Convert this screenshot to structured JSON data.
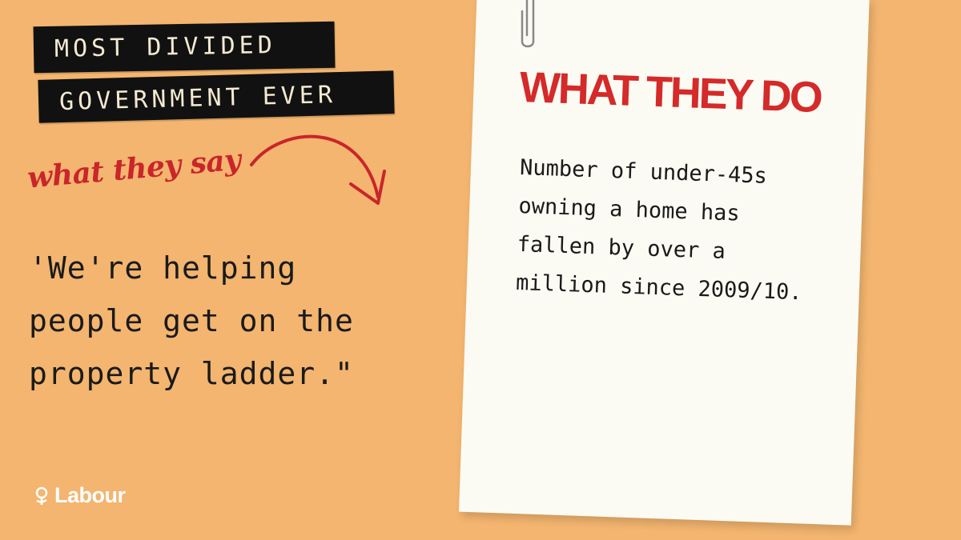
{
  "headline": {
    "line1": "MOST DIVIDED",
    "line2": "GOVERNMENT EVER"
  },
  "what_they_say": {
    "label": "what they say",
    "quote": "'We're helping\npeople get on the\nproperty ladder.\""
  },
  "what_they_do": {
    "title": "WHAT THEY DO",
    "fact": "Number of under-45s\nowning a home has\nfallen by over a\nmillion since 2009/10."
  },
  "logo": {
    "text": "Labour",
    "icon": "rose-icon"
  },
  "colors": {
    "background": "#f3b56f",
    "accent_red": "#d42a2a",
    "strip_black": "#111111",
    "paper": "#fcfbf3"
  }
}
